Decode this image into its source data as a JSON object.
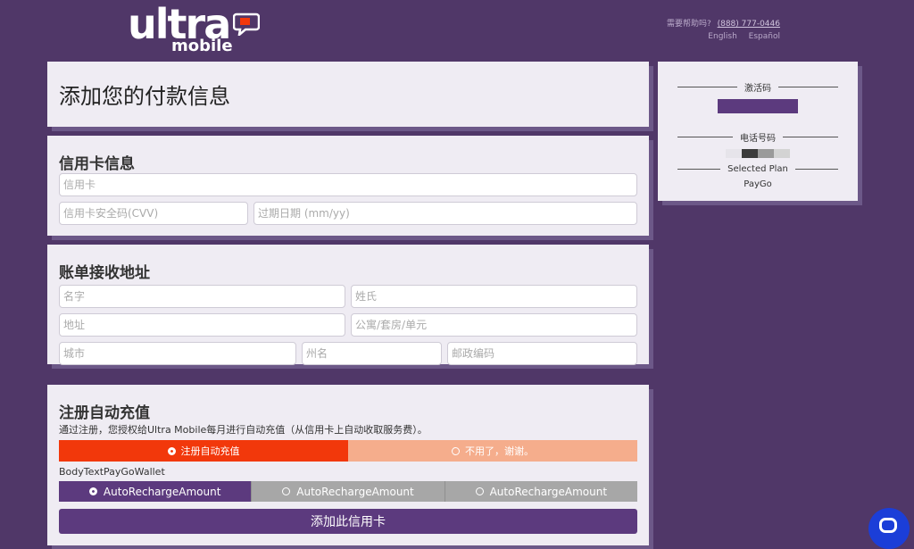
{
  "header": {
    "logo_word": "ultra",
    "logo_sub": "mobile",
    "help_text": "需要帮助吗?",
    "help_phone": "(888) 777-0446",
    "languages": [
      "English",
      "Español"
    ]
  },
  "title": "添加您的付款信息",
  "card_section": {
    "title": "信用卡信息",
    "card_placeholder": "信用卡",
    "cvv_placeholder": "信用卡安全码(CVV)",
    "expiry_placeholder": "过期日期 (mm/yy)"
  },
  "billing_section": {
    "title": "账单接收地址",
    "first_name": "名字",
    "last_name": "姓氏",
    "address": "地址",
    "apt": "公寓/套房/单元",
    "city": "城市",
    "state": "州名",
    "zip": "邮政编码"
  },
  "auto_section": {
    "title": "注册自动充值",
    "note": "通过注册，您授权给Ultra Mobile每月进行自动充值（从信用卡上自动收取服务费）。",
    "choices": [
      {
        "label": "注册自动充值",
        "selected": true
      },
      {
        "label": "不用了，谢谢。",
        "selected": false
      }
    ],
    "wallet_label": "BodyTextPayGoWallet",
    "amounts": [
      {
        "label": "AutoRechargeAmount",
        "selected": true
      },
      {
        "label": "AutoRechargeAmount",
        "selected": false
      },
      {
        "label": "AutoRechargeAmount",
        "selected": false
      }
    ],
    "submit_label": "添加此信用卡"
  },
  "side": {
    "activation_label": "激活码",
    "phone_label": "电话号码",
    "plan_label": "Selected Plan",
    "plan_value": "PayGo"
  },
  "colors": {
    "background": "#503768",
    "brand_purple": "#5c3a7e",
    "accent_orange": "#f2380b",
    "chat_blue": "#1b3ed8"
  },
  "icons": [
    "logo-bubble-icon",
    "radio-icon",
    "chat-icon"
  ]
}
